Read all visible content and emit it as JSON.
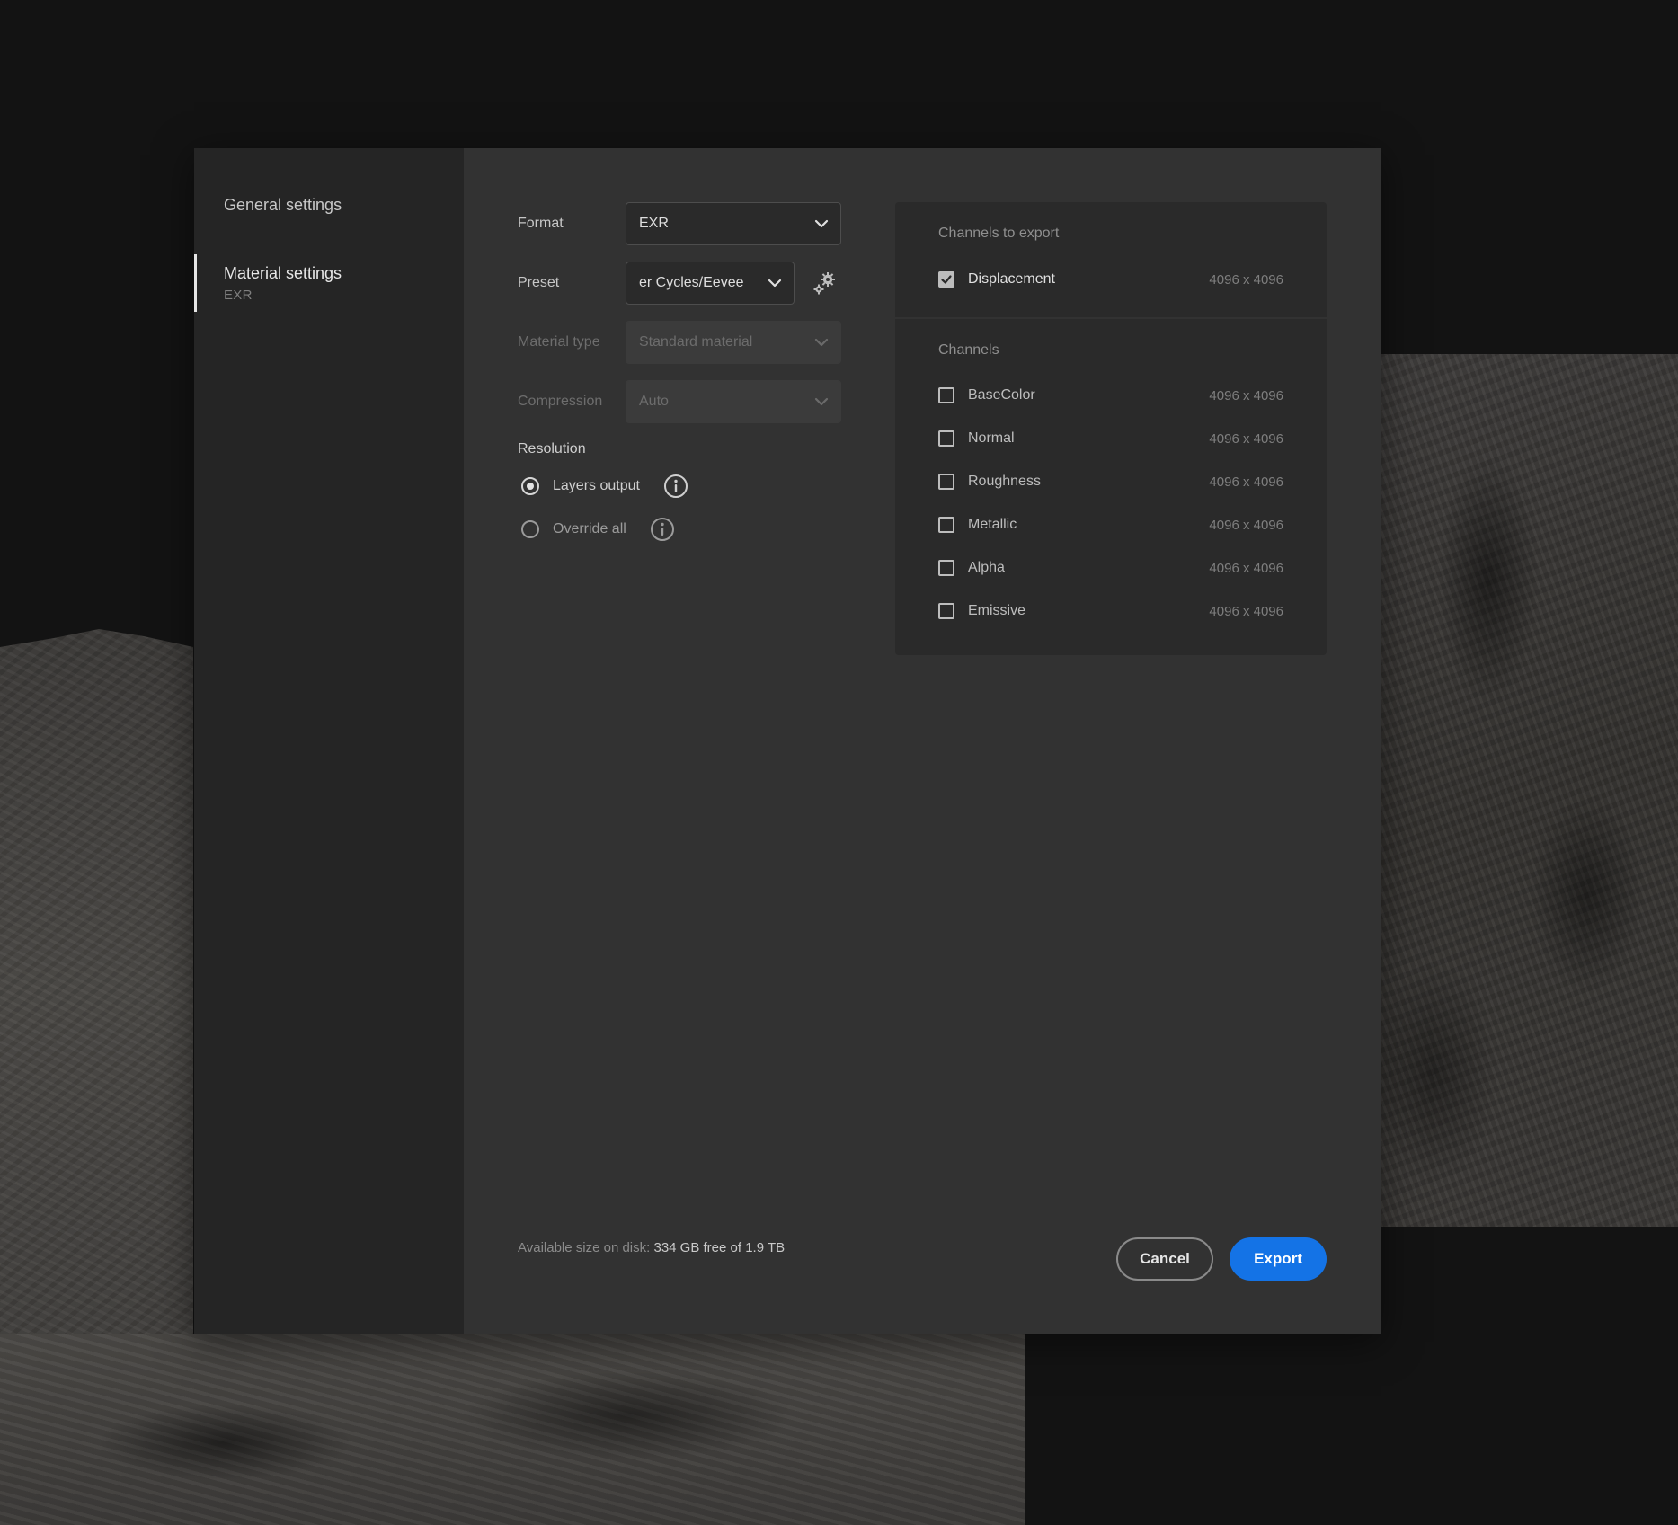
{
  "sidebar": {
    "items": [
      {
        "label": "General settings",
        "sub": ""
      },
      {
        "label": "Material settings",
        "sub": "EXR"
      }
    ]
  },
  "form": {
    "format": {
      "label": "Format",
      "value": "EXR"
    },
    "preset": {
      "label": "Preset",
      "value": "er Cycles/Eevee"
    },
    "material_type": {
      "label": "Material type",
      "value": "Standard material"
    },
    "compression": {
      "label": "Compression",
      "value": "Auto"
    }
  },
  "resolution": {
    "title": "Resolution",
    "options": [
      {
        "label": "Layers output",
        "selected": true
      },
      {
        "label": "Override all",
        "selected": false
      }
    ]
  },
  "channels_panel": {
    "export_title": "Channels to export",
    "export_items": [
      {
        "name": "Displacement",
        "resolution": "4096 x 4096",
        "checked": true
      }
    ],
    "channels_title": "Channels",
    "channels": [
      {
        "name": "BaseColor",
        "resolution": "4096 x 4096",
        "checked": false
      },
      {
        "name": "Normal",
        "resolution": "4096 x 4096",
        "checked": false
      },
      {
        "name": "Roughness",
        "resolution": "4096 x 4096",
        "checked": false
      },
      {
        "name": "Metallic",
        "resolution": "4096 x 4096",
        "checked": false
      },
      {
        "name": "Alpha",
        "resolution": "4096 x 4096",
        "checked": false
      },
      {
        "name": "Emissive",
        "resolution": "4096 x 4096",
        "checked": false
      }
    ]
  },
  "footer": {
    "disk_label": "Available size on disk:",
    "disk_value": "334 GB free of 1.9 TB",
    "cancel_label": "Cancel",
    "export_label": "Export"
  },
  "icons": {
    "chevron": "chevron-down-icon",
    "gear": "gear-icon",
    "info": "info-icon",
    "check": "check-icon"
  },
  "colors": {
    "accent": "#1473e6",
    "dialog_bg": "#323232",
    "sidebar_bg": "#252525",
    "panel_bg": "#2a2a2a"
  }
}
